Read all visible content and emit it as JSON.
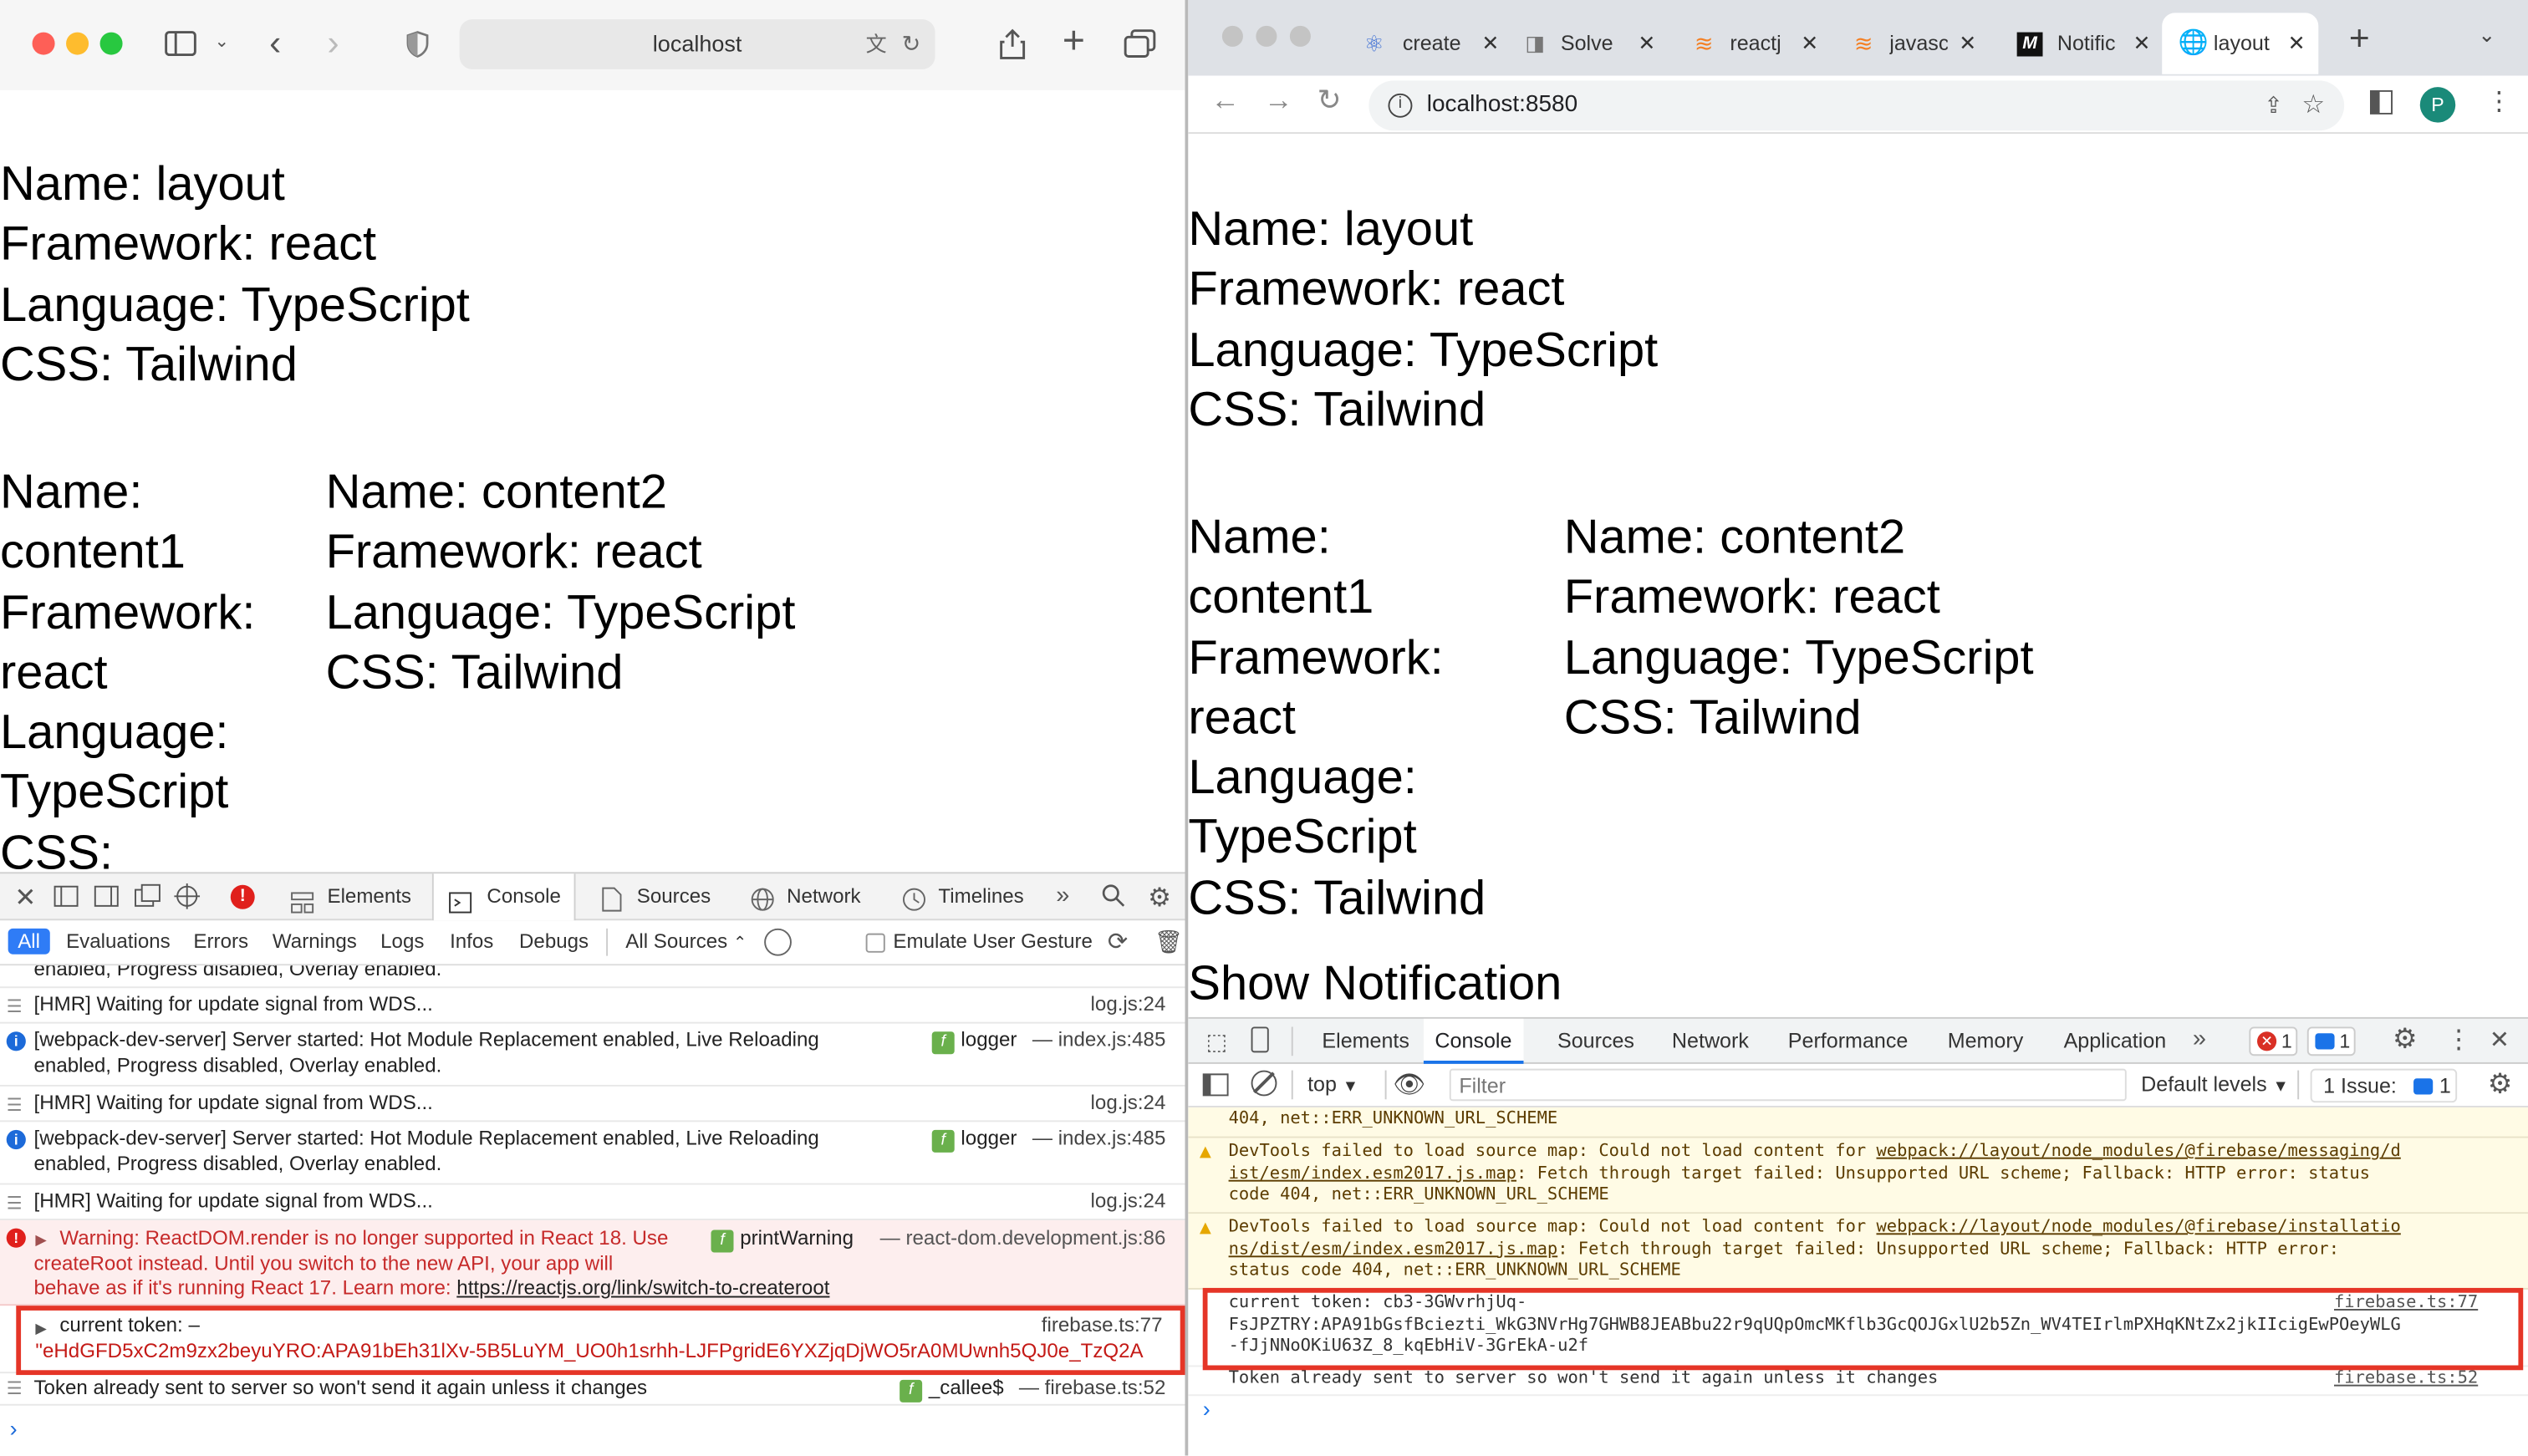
{
  "safari": {
    "url": "localhost",
    "page": {
      "layout_block": "Name: layout\nFramework: react\nLanguage: TypeScript\nCSS: Tailwind",
      "content1_block": "Name:\ncontent1\nFramework:\nreact\nLanguage:\nTypeScript\nCSS:",
      "content2_block": "Name: content2\nFramework: react\nLanguage: TypeScript\nCSS: Tailwind"
    },
    "devtools": {
      "tabs": [
        "Elements",
        "Console",
        "Sources",
        "Network",
        "Timelines"
      ],
      "filters": [
        "All",
        "Evaluations",
        "Errors",
        "Warnings",
        "Logs",
        "Infos",
        "Debugs"
      ],
      "all_sources": "All Sources",
      "emulate": "Emulate User Gesture",
      "truncated_top": "enabled, Progress disabled, Overlay enabled.",
      "logs": [
        {
          "msg": "[HMR] Waiting for update signal from WDS...",
          "src": "log.js:24"
        },
        {
          "msg": "[webpack-dev-server] Server started: Hot Module Replacement enabled, Live Reloading\nenabled, Progress disabled, Overlay enabled.",
          "fn": "logger",
          "src": "— index.js:485"
        },
        {
          "msg": "[HMR] Waiting for update signal from WDS...",
          "src": "log.js:24"
        },
        {
          "msg": "[webpack-dev-server] Server started: Hot Module Replacement enabled, Live Reloading\nenabled, Progress disabled, Overlay enabled.",
          "fn": "logger",
          "src": "— index.js:485"
        },
        {
          "msg": "[HMR] Waiting for update signal from WDS...",
          "src": "log.js:24"
        }
      ],
      "warning": {
        "line1": "Warning: ReactDOM.render is no longer supported in React 18. Use",
        "line2": "createRoot instead. Until you switch to the new API, your app will",
        "line3": "behave as if it's running React 17. Learn more: ",
        "link": "https://reactjs.org/link/switch-to-createroot",
        "fn": "printWarning",
        "src": "— react-dom.development.js:86"
      },
      "token": {
        "label": "current token: –",
        "value": "\"eHdGFD5xC2m9zx2beyuYRO:APA91bEh31lXv-5B5LuYM_UO0h1srhh-LJFPgridE6YXZjqDjWO5rA0MUwnh5QJ0e_TzQ2A",
        "src": "firebase.ts:77"
      },
      "sent": {
        "msg": "Token already sent to server so won't send it again unless it changes",
        "fn": "_callee$",
        "src": "— firebase.ts:52"
      }
    }
  },
  "chrome": {
    "tabs": [
      "create",
      "Solve",
      "reactj",
      "javasc",
      "Notific",
      "layout"
    ],
    "url": "localhost:8580",
    "profile": "P",
    "page": {
      "layout_block": "Name: layout\nFramework: react\nLanguage: TypeScript\nCSS: Tailwind",
      "content1_block": "Name:\ncontent1\nFramework:\nreact\nLanguage:\nTypeScript\nCSS: Tailwind",
      "content2_block": "Name: content2\nFramework: react\nLanguage: TypeScript\nCSS: Tailwind",
      "show_notification": "Show Notification"
    },
    "devtools": {
      "tabs": [
        "Elements",
        "Console",
        "Sources",
        "Network",
        "Performance",
        "Memory",
        "Application"
      ],
      "error_count": "1",
      "message_count": "1",
      "context": "top",
      "filter_placeholder": "Filter",
      "levels": "Default levels",
      "issues": "1 Issue:",
      "issues_count": "1",
      "truncated_top": "404, net::ERR_UNKNOWN_URL_SCHEME",
      "warn1": {
        "pre": "DevTools failed to load source map: Could not load content for ",
        "link": "webpack://layout/node_modules/@firebase/messaging/d\nist/esm/index.esm2017.js.map",
        "post": ": Fetch through target failed: Unsupported URL scheme; Fallback: HTTP error: status\ncode 404, net::ERR_UNKNOWN_URL_SCHEME"
      },
      "warn2": {
        "pre": "DevTools failed to load source map: Could not load content for ",
        "link": "webpack://layout/node_modules/@firebase/installatio\nns/dist/esm/index.esm2017.js.map",
        "post": ": Fetch through target failed: Unsupported URL scheme; Fallback: HTTP error:\nstatus code 404, net::ERR_UNKNOWN_URL_SCHEME"
      },
      "token": {
        "text": "current token: cb3-3GWvrhjUq-\nFsJPZTRY:APA91bGsfBciezti_WkG3NVrHg7GHWB8JEABbu22r9qUQpOmcMKflb3GcQOJGxlU2b5Zn_WV4TEIrlmPXHqKNtZx2jkIIcigEwPOeyWLG\n-fJjNNoOKiU63Z_8_kqEbHiV-3GrEkA-u2f",
        "src": "firebase.ts:77"
      },
      "sent": {
        "msg": "Token already sent to server so won't send it again unless it changes",
        "src": "firebase.ts:52"
      }
    }
  }
}
